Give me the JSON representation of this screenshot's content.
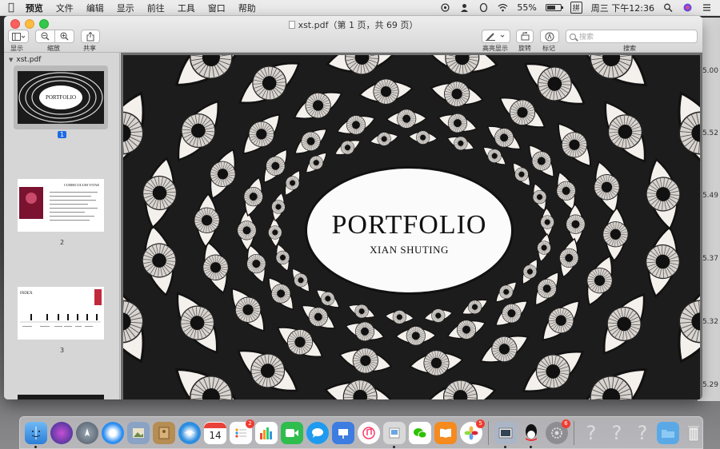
{
  "menubar": {
    "app_name": "预览",
    "items": [
      "文件",
      "编辑",
      "显示",
      "前往",
      "工具",
      "窗口",
      "帮助"
    ],
    "battery": "55%",
    "input_method": "拼",
    "clock": "周三 下午12:36"
  },
  "window": {
    "title": "xst.pdf（第 1 页，共 69 页）",
    "toolbar": {
      "view_label": "显示",
      "zoom_label": "缩放",
      "share_label": "共享",
      "highlight_label": "高亮显示",
      "rotate_label": "旋转",
      "markup_label": "标记",
      "search_label": "搜索",
      "search_placeholder": "搜索"
    }
  },
  "sidebar": {
    "file_name": "xst.pdf",
    "thumbnails": [
      {
        "page": "1",
        "selected": true,
        "title": "PORTFOLIO"
      },
      {
        "page": "2",
        "selected": false,
        "title": "CURRICULUM VITAE"
      },
      {
        "page": "3",
        "selected": false,
        "title": "INDEX"
      }
    ]
  },
  "document": {
    "title": "PORTFOLIO",
    "subtitle": "XIAN SHUTING"
  },
  "desktop_ticks": [
    "5.00",
    "5.52",
    "5.49",
    "5.37",
    "5.32",
    "5.29"
  ],
  "dock": {
    "badges": {
      "reminders": "2",
      "photos": "5",
      "qq": "6"
    },
    "calendar_day": "14"
  },
  "colors": {
    "accent": "#1d6ae5",
    "close": "#fc605c",
    "minimize": "#fdbc40",
    "maximize": "#34c84a"
  }
}
